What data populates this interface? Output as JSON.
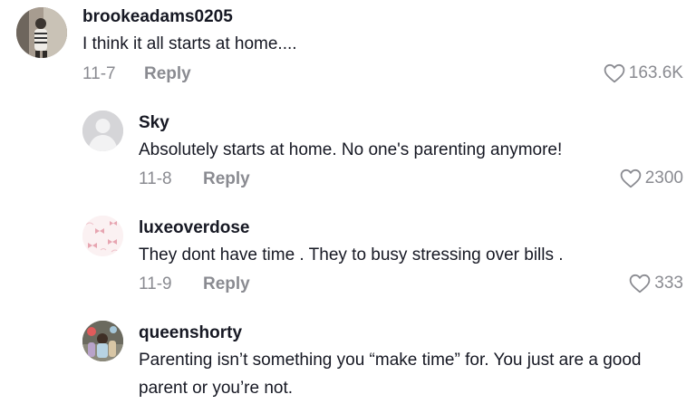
{
  "comments": [
    {
      "username": "brookeadams0205",
      "text": "I think it all starts at home....",
      "date": "11-7",
      "reply_label": "Reply",
      "likes": "163.6K",
      "avatar": "photo-avatar"
    },
    {
      "username": "Sky",
      "text": "Absolutely starts at home. No one's parenting anymore!",
      "date": "11-8",
      "reply_label": "Reply",
      "likes": "2300",
      "avatar": "default-gray-avatar"
    },
    {
      "username": "luxeoverdose",
      "text": "They dont have time . They to busy stressing over bills .",
      "date": "11-9",
      "reply_label": "Reply",
      "likes": "333",
      "avatar": "pink-bow-avatar"
    },
    {
      "username": "queenshorty",
      "text": "Parenting isn’t something you “make time” for. You just are a good parent or you’re not.",
      "avatar": "photo-avatar"
    }
  ],
  "colors": {
    "text": "#161823",
    "secondary": "#8a8b91"
  }
}
